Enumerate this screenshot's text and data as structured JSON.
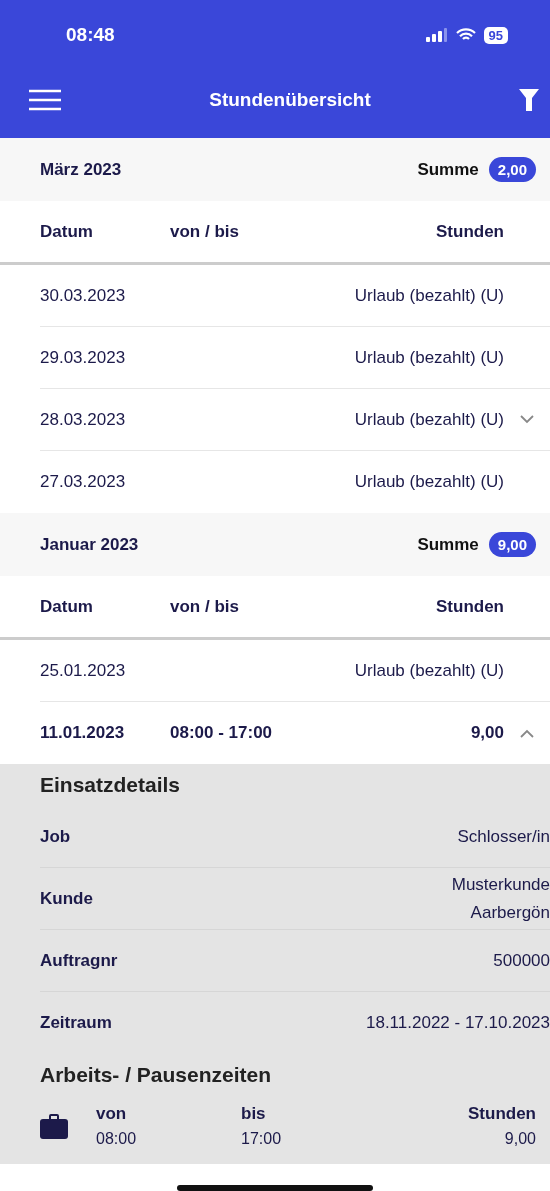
{
  "status_bar": {
    "time": "08:48",
    "battery": "95"
  },
  "nav": {
    "title": "Stundenübersicht"
  },
  "months": [
    {
      "title": "März 2023",
      "sum_label": "Summe",
      "sum": "2,00",
      "columns": [
        "Datum",
        "von / bis",
        "Stunden"
      ],
      "rows": [
        {
          "date": "30.03.2023",
          "hours": "Urlaub (bezahlt) (U)"
        },
        {
          "date": "29.03.2023",
          "hours": "Urlaub (bezahlt) (U)"
        },
        {
          "date": "28.03.2023",
          "hours": "Urlaub (bezahlt) (U)",
          "expanded": false
        },
        {
          "date": "27.03.2023",
          "hours": "Urlaub (bezahlt) (U)"
        }
      ]
    },
    {
      "title": "Januar 2023",
      "sum_label": "Summe",
      "sum": "9,00",
      "columns": [
        "Datum",
        "von / bis",
        "Stunden"
      ],
      "rows": [
        {
          "date": "25.01.2023",
          "hours": "Urlaub (bezahlt) (U)"
        },
        {
          "date": "11.01.2023",
          "time": "08:00 - 17:00",
          "hours": "9,00",
          "expanded": true,
          "details": {
            "title": "Einsatzdetails",
            "fields": [
              {
                "label": "Job",
                "value": "Schlosser/in"
              },
              {
                "label": "Kunde",
                "value": "Musterkunde Aarbergön"
              },
              {
                "label": "Auftragnr",
                "value": "500000"
              },
              {
                "label": "Zeitraum",
                "value": "18.11.2022 - 17.10.2023"
              }
            ],
            "times_title": "Arbeits- / Pausenzeiten",
            "times": [
              {
                "from_label": "von",
                "from": "08:00",
                "to_label": "bis",
                "to": "17:00",
                "hours_label": "Stunden",
                "hours": "9,00"
              }
            ]
          }
        }
      ]
    }
  ]
}
